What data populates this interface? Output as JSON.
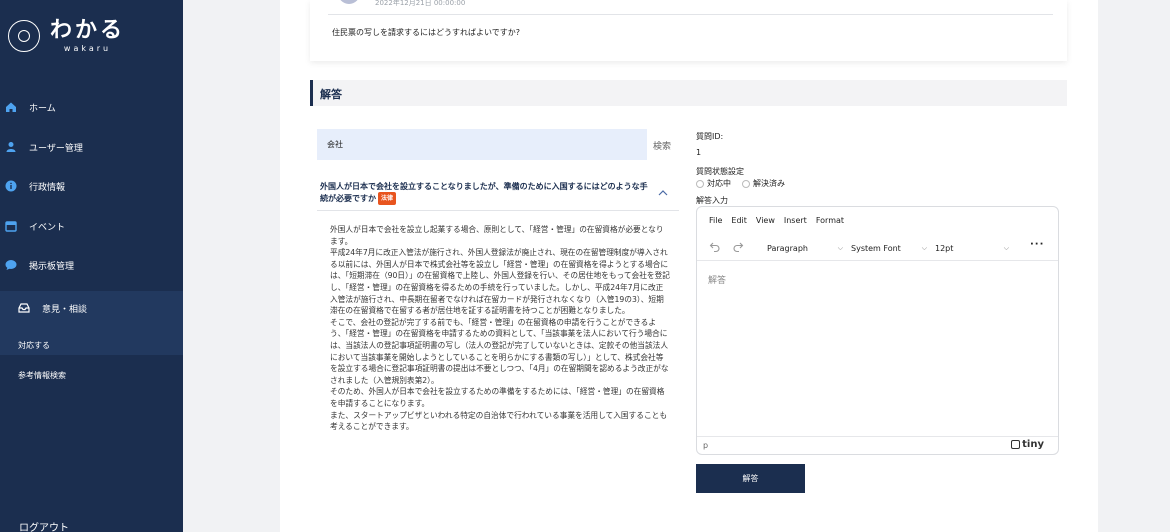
{
  "brand": {
    "name": "わかる",
    "sub": "wakaru"
  },
  "nav": [
    {
      "label": "ホーム",
      "icon": "home-icon"
    },
    {
      "label": "ユーザー管理",
      "icon": "user-icon"
    },
    {
      "label": "行政情報",
      "icon": "info-icon"
    },
    {
      "label": "イベント",
      "icon": "calendar-icon"
    },
    {
      "label": "掲示板管理",
      "icon": "chat-icon"
    },
    {
      "label": "意見・相談",
      "icon": "inbox-icon"
    }
  ],
  "subnav": [
    "対応する",
    "参考情報検索"
  ],
  "logout": "ログアウト",
  "question": {
    "date": "2022年12月21日 00:00:00",
    "text": "住民票の写しを請求するにはどうすればよいですか?"
  },
  "section": {
    "title": "解答"
  },
  "search": {
    "value": "会社",
    "button": "検索"
  },
  "accordion": {
    "title": "外国人が日本で会社を設立することなりましたが、準備のために入国するにはどのような手続が必要ですか",
    "badge": "法律",
    "paragraphs": [
      "外国人が日本で会社を設立し起業する場合、原則として、「経営・管理」の在留資格が必要となります。",
      "平成24年7月に改正入管法が施行され、外国人登録法が廃止され、現在の在留管理制度が導入される以前には、外国人が日本で株式会社等を設立し「経営・管理」の在留資格を得ようとする場合には、「短期滞在（90日）」の在留資格で上陸し、外国人登録を行い、その居住地をもって会社を登記し、「経営・管理」の在留資格を得るための手続を行っていました。しかし、平成24年7月に改正入管法が施行され、中長期在留者でなければ在留カードが発行されなくなり（入管19の3）、短期滞在の在留資格で在留する者が居住地を証する証明書を持つことが困難となりました。",
      "そこで、会社の登記が完了する前でも、「経営・管理」の在留資格の申請を行うことができるよう、「経営・管理」の在留資格を申請するための資料として、「当該事業を法人において行う場合には、当該法人の登記事項証明書の写し（法人の登記が完了していないときは、定款その他当該法人において当該事業を開始しようとしていることを明らかにする書類の写し）」として、株式会社等を設立する場合に登記事項証明書の提出は不要としつつ、「4月」の在留期間を認めるよう改正がなされました（入管規別表第2）。",
      "そのため、外国人が日本で会社を設立するための準備をするためには、「経営・管理」の在留資格を申請することになります。",
      "また、スタートアップビザといわれる特定の自治体で行われている事業を活用して入国することも考えることができます。"
    ]
  },
  "form": {
    "id_label": "質問ID:",
    "id_value": "1",
    "status_label": "質問状態設定",
    "status_options": [
      "対応中",
      "解決済み"
    ],
    "answer_label": "解答入力",
    "submit": "解答"
  },
  "editor": {
    "menu": [
      "File",
      "Edit",
      "View",
      "Insert",
      "Format"
    ],
    "block_format": "Paragraph",
    "font_family": "System Font",
    "font_size": "12pt",
    "placeholder": "解答",
    "path": "p",
    "brand": "tiny"
  }
}
